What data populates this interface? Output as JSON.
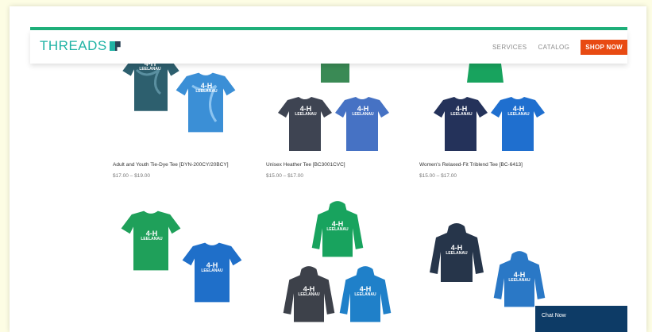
{
  "header": {
    "logo_text": "THREADS",
    "nav": [
      "SERVICES",
      "CATALOG"
    ],
    "shop_label": "SHOP NOW"
  },
  "products": [
    {
      "title": "Adult and Youth Tie-Dye Tee [DYN-200CY/20BCY]",
      "price": "$17.00 – $19.00"
    },
    {
      "title": "Unisex Heather Tee [BC3001CVC]",
      "price": "$15.00 – $17.00"
    },
    {
      "title": "Women's Relaxed-Fit Triblend Tee [BC-6413]",
      "price": "$15.00 – $17.00"
    }
  ],
  "print": {
    "mark": "4-H",
    "name": "LEELANAU",
    "sub": "COUNTY"
  },
  "chat": {
    "label": "Chat Now"
  },
  "colors": {
    "accent_green": "#1fb07a",
    "logo_teal": "#1fb3a5",
    "shop_orange": "#e84a12",
    "chat_navy": "#0d3b66"
  }
}
